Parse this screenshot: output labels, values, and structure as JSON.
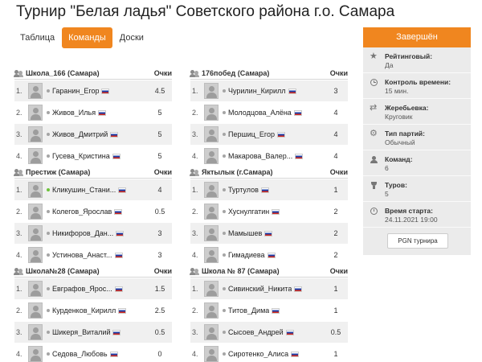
{
  "page": {
    "title": "Турнир \"Белая ладья\" Советского района г.о. Самара"
  },
  "tabs": [
    {
      "label": "Таблица"
    },
    {
      "label": "Команды"
    },
    {
      "label": "Доски"
    }
  ],
  "points_header": "Очки",
  "teams": [
    {
      "name": "Школа_166 (Самара)",
      "players": [
        {
          "num": "1.",
          "name": "Гаранин_Егор",
          "points": "4.5"
        },
        {
          "num": "2.",
          "name": "Живов_Илья",
          "points": "5"
        },
        {
          "num": "3.",
          "name": "Живов_Дмитрий",
          "points": "5"
        },
        {
          "num": "4.",
          "name": "Гусева_Кристина",
          "points": "5"
        }
      ]
    },
    {
      "name": "176побед (Самара)",
      "players": [
        {
          "num": "1.",
          "name": "Чурилин_Кирилл",
          "points": "3"
        },
        {
          "num": "2.",
          "name": "Молодцова_Алёна",
          "points": "4"
        },
        {
          "num": "3.",
          "name": "Першиц_Егор",
          "points": "4"
        },
        {
          "num": "4.",
          "name": "Макарова_Валер...",
          "points": "4"
        }
      ]
    },
    {
      "name": "Престиж (Самара)",
      "players": [
        {
          "num": "1.",
          "name": "Кликушин_Стани...",
          "points": "4"
        },
        {
          "num": "2.",
          "name": "Колегов_Ярослав",
          "points": "0.5"
        },
        {
          "num": "3.",
          "name": "Никифоров_Дан...",
          "points": "3"
        },
        {
          "num": "4.",
          "name": "Устинова_Анаст...",
          "points": "3"
        }
      ]
    },
    {
      "name": "Яктылык (г.Самара)",
      "players": [
        {
          "num": "1.",
          "name": "Туртулов",
          "points": "1"
        },
        {
          "num": "2.",
          "name": "Хуснулгатин",
          "points": "2"
        },
        {
          "num": "3.",
          "name": "Мамышев",
          "points": "2"
        },
        {
          "num": "4.",
          "name": "Гимадиева",
          "points": "2"
        }
      ]
    },
    {
      "name": "Школа№28 (Самара)",
      "players": [
        {
          "num": "1.",
          "name": "Евграфов_Ярос...",
          "points": "1.5"
        },
        {
          "num": "2.",
          "name": "Курденков_Кирилл",
          "points": "2.5"
        },
        {
          "num": "3.",
          "name": "Шикеря_Виталий",
          "points": "0.5"
        },
        {
          "num": "4.",
          "name": "Седова_Любовь",
          "points": "0"
        }
      ]
    },
    {
      "name": "Школа № 87 (Самара)",
      "players": [
        {
          "num": "1.",
          "name": "Сивинский_Никита",
          "points": "1"
        },
        {
          "num": "2.",
          "name": "Титов_Дима",
          "points": "1"
        },
        {
          "num": "3.",
          "name": "Сысоев_Андрей",
          "points": "0.5"
        },
        {
          "num": "4.",
          "name": "Сиротенко_Алиса",
          "points": "1"
        }
      ]
    }
  ],
  "panel": {
    "status": "Завершён",
    "rows": [
      {
        "icon": "star-icon",
        "label": "Рейтинговый:",
        "value": "Да"
      },
      {
        "icon": "clock-icon",
        "label": "Контроль времени:",
        "value": "15 мин."
      },
      {
        "icon": "shuffle-icon",
        "label": "Жеребьевка:",
        "value": "Круговик"
      },
      {
        "icon": "gear-icon",
        "label": "Тип партий:",
        "value": "Обычный"
      },
      {
        "icon": "people-icon",
        "label": "Команд:",
        "value": "6"
      },
      {
        "icon": "trophy-icon",
        "label": "Туров:",
        "value": "5"
      },
      {
        "icon": "calendar-icon",
        "label": "Время старта:",
        "value": "24.11.2021 19:00"
      }
    ],
    "pgn_label": "PGN турнира"
  },
  "colors": {
    "accent": "#f0861f",
    "panel_bg": "#ebebeb",
    "row_shade": "#f0f0f0",
    "online": "#6dc23a"
  }
}
